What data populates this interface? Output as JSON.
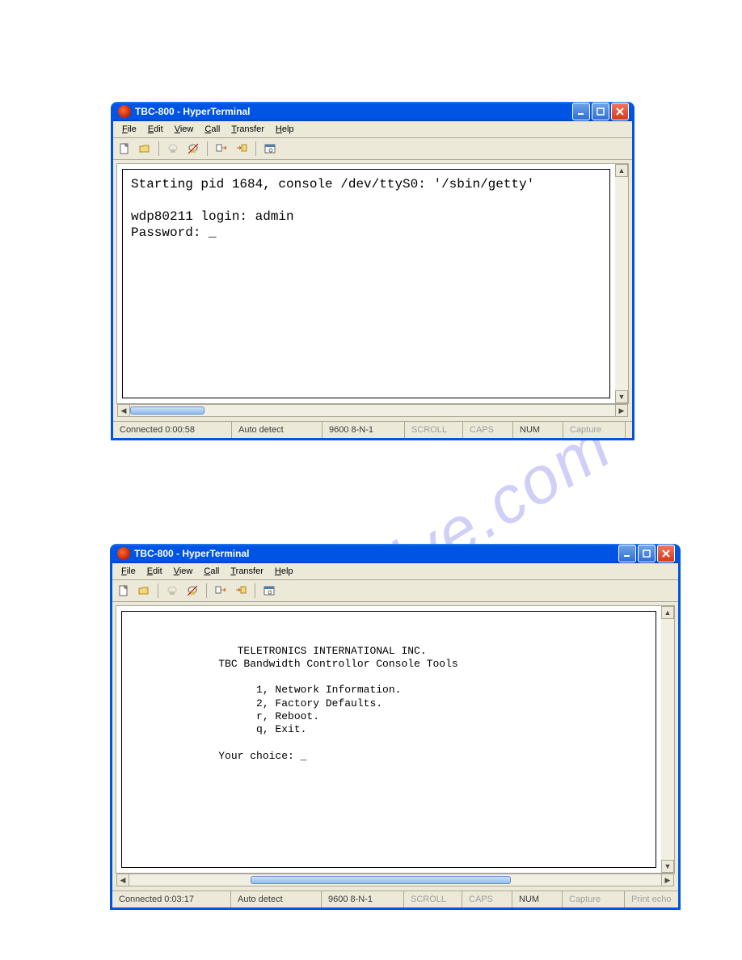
{
  "watermark": "manualshive.com",
  "menu": {
    "file": "File",
    "edit": "Edit",
    "view": "View",
    "call": "Call",
    "transfer": "Transfer",
    "help": "Help"
  },
  "status": {
    "auto": "Auto detect",
    "port": "9600 8-N-1",
    "scroll": "SCROLL",
    "caps": "CAPS",
    "num": "NUM",
    "capture": "Capture",
    "printecho": "Print echo"
  },
  "win1": {
    "title": "TBC-800 - HyperTerminal",
    "terminal": "Starting pid 1684, console /dev/ttyS0: '/sbin/getty'\n\nwdp80211 login: admin\nPassword: _",
    "connected": "Connected 0:00:58"
  },
  "win2": {
    "title": "TBC-800 - HyperTerminal",
    "terminal": "\n\n                 TELETRONICS INTERNATIONAL INC.\n              TBC Bandwidth Controllor Console Tools\n\n                    1, Network Information.\n                    2, Factory Defaults.\n                    r, Reboot.\n                    q, Exit.\n\n              Your choice: _",
    "connected": "Connected 0:03:17"
  }
}
